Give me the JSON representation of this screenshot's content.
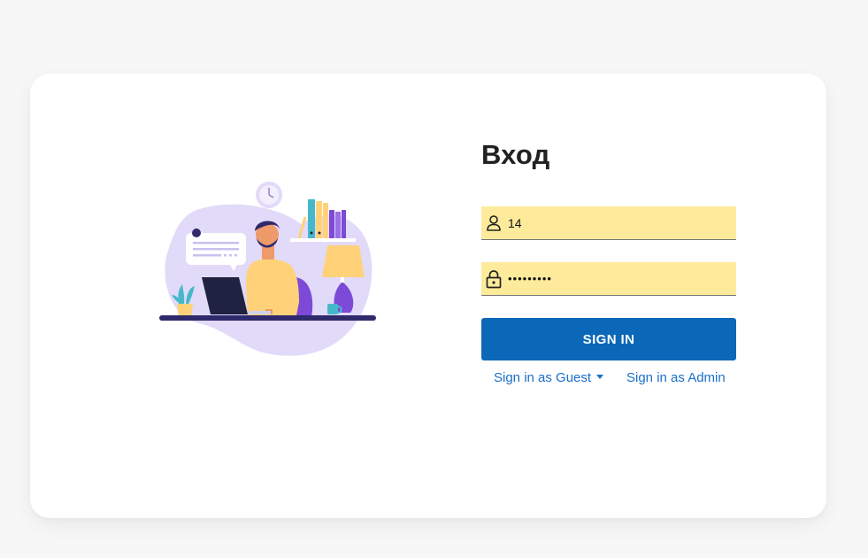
{
  "login": {
    "title": "Вход",
    "username_value": "14",
    "password_value": "123456789",
    "sign_in_label": "SIGN IN",
    "guest_link_label": "Sign in as Guest",
    "admin_link_label": "Sign in as Admin"
  },
  "icons": {
    "username": "person-icon",
    "password": "lock-icon",
    "guest_dropdown": "caret-down-icon"
  },
  "colors": {
    "page_background": "#f7f7f8",
    "card_background": "#ffffff",
    "input_autofill": "#fdeb9b",
    "button_primary": "#0b67b8",
    "link": "#1a6fc9",
    "illustration_blob": "#e2daf9",
    "illustration_accent": "#ffd27a"
  }
}
